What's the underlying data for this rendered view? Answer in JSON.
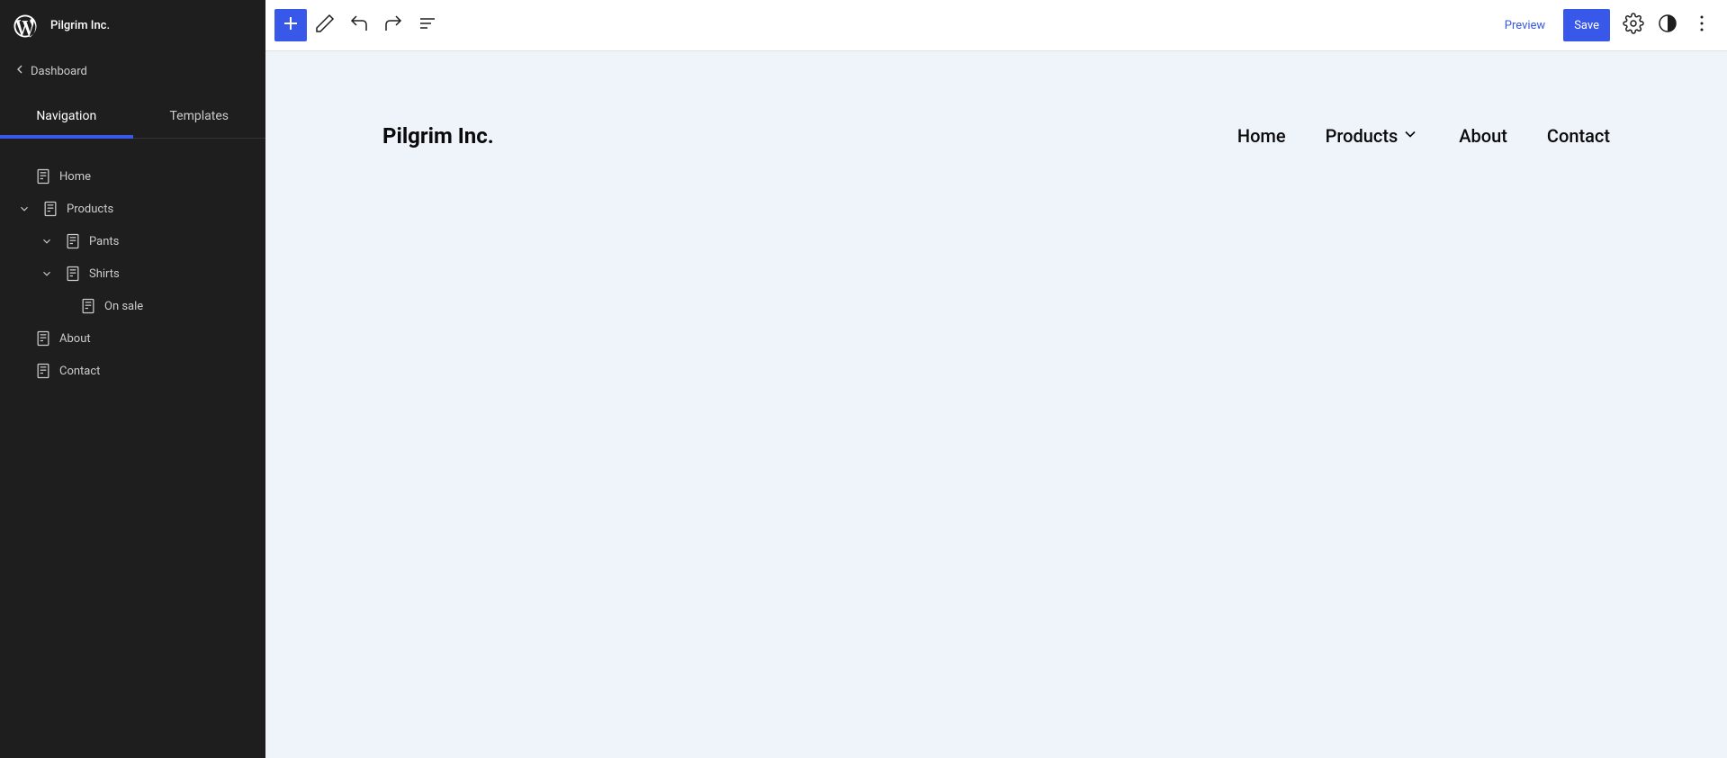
{
  "site": {
    "title": "Pilgrim Inc."
  },
  "sidebar": {
    "back_label": "Dashboard",
    "tabs": {
      "navigation": "Navigation",
      "templates": "Templates"
    },
    "items": [
      {
        "label": "Home"
      },
      {
        "label": "Products"
      },
      {
        "label": "Pants"
      },
      {
        "label": "Shirts"
      },
      {
        "label": "On sale"
      },
      {
        "label": "About"
      },
      {
        "label": "Contact"
      }
    ]
  },
  "toolbar": {
    "preview_label": "Preview",
    "save_label": "Save"
  },
  "preview": {
    "title": "Pilgrim Inc.",
    "nav": {
      "home": "Home",
      "products": "Products",
      "about": "About",
      "contact": "Contact"
    }
  }
}
